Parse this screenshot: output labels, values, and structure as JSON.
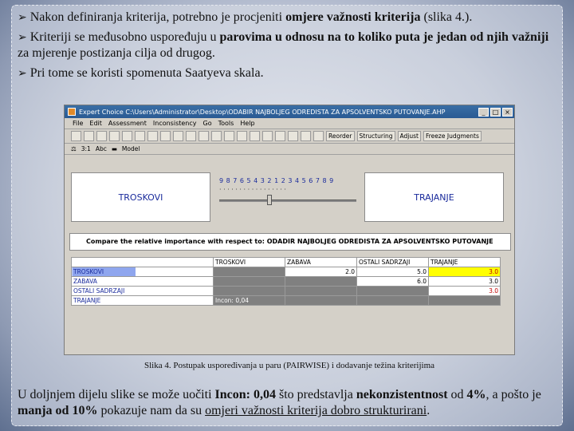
{
  "bullets": [
    {
      "pre": "Nakon definiranja kriterija, potrebno je procjeniti ",
      "bold": "omjere važnosti kriterija",
      "post": " (slika 4.)."
    },
    {
      "pre": "Kriteriji se međusobno uspoređuju u ",
      "bold": "parovima u odnosu na to koliko puta je jedan od njih važniji",
      "post": " za mjerenje postizanja cilja od drugog."
    },
    {
      "pre": "Pri tome se koristi spomenuta Saatyeva skala.",
      "bold": "",
      "post": ""
    }
  ],
  "bullet_icon": "arrow-bullet-icon",
  "app": {
    "title": "Expert Choice    C:\\Users\\Administrator\\Desktop\\ODABIR NAJBOLJEG ODREDISTA ZA APSOLVENTSKO PUTOVANJE.AHP",
    "menu": [
      "File",
      "Edit",
      "Assessment",
      "Inconsistency",
      "Go",
      "Tools",
      "Help"
    ],
    "toolbar_buttons": [
      "Reorder",
      "Structuring",
      "Adjust",
      "Freeze Judgments"
    ],
    "toolbar2": [
      "3:1",
      "Abc",
      "Model"
    ],
    "left_criterion": "TROSKOVI",
    "right_criterion": "TRAJANJE",
    "scale_numbers": "9  8  7  6  5  4  3  2  1  2  3  4  5  6  7  8  9",
    "compare_text": "Compare the relative importance  with respect to: ODADIR NAJBOLJEG ODREDISTA ZA APSOLVENTSKO PUTOVANJE",
    "columns": [
      "TROSKOVI",
      "ZABAVA",
      "OSTALI SADRZAJI",
      "TRAJANJE"
    ],
    "rows": [
      {
        "label": "TROSKOVI",
        "cells": [
          "",
          "2.0",
          "5.0",
          "3.0"
        ]
      },
      {
        "label": "ZABAVA",
        "cells": [
          "",
          "",
          "6.0",
          "3.0"
        ]
      },
      {
        "label": "OSTALI SADRZAJI",
        "cells": [
          "",
          "",
          "",
          "3.0"
        ]
      },
      {
        "label": "TRAJANJE",
        "cells": [
          "Incon: 0,04",
          "",
          "",
          ""
        ]
      }
    ]
  },
  "caption": "Slika 4. Postupak uspoređivanja u paru (PAIRWISE) i dodavanje težina kriterijima",
  "para": {
    "p1": "U doljnjem dijelu slike se može uočiti ",
    "b1": "Incon: 0,04",
    "p2": " što predstavlja ",
    "b2": "nekonzistentnost",
    "p3": " od ",
    "b3": "4%",
    "p4": ", a pošto je ",
    "b4": "manja od 10%",
    "p5": " pokazuje nam da su ",
    "u1": "omjeri važnosti kriterija dobro strukturirani",
    "p6": "."
  }
}
